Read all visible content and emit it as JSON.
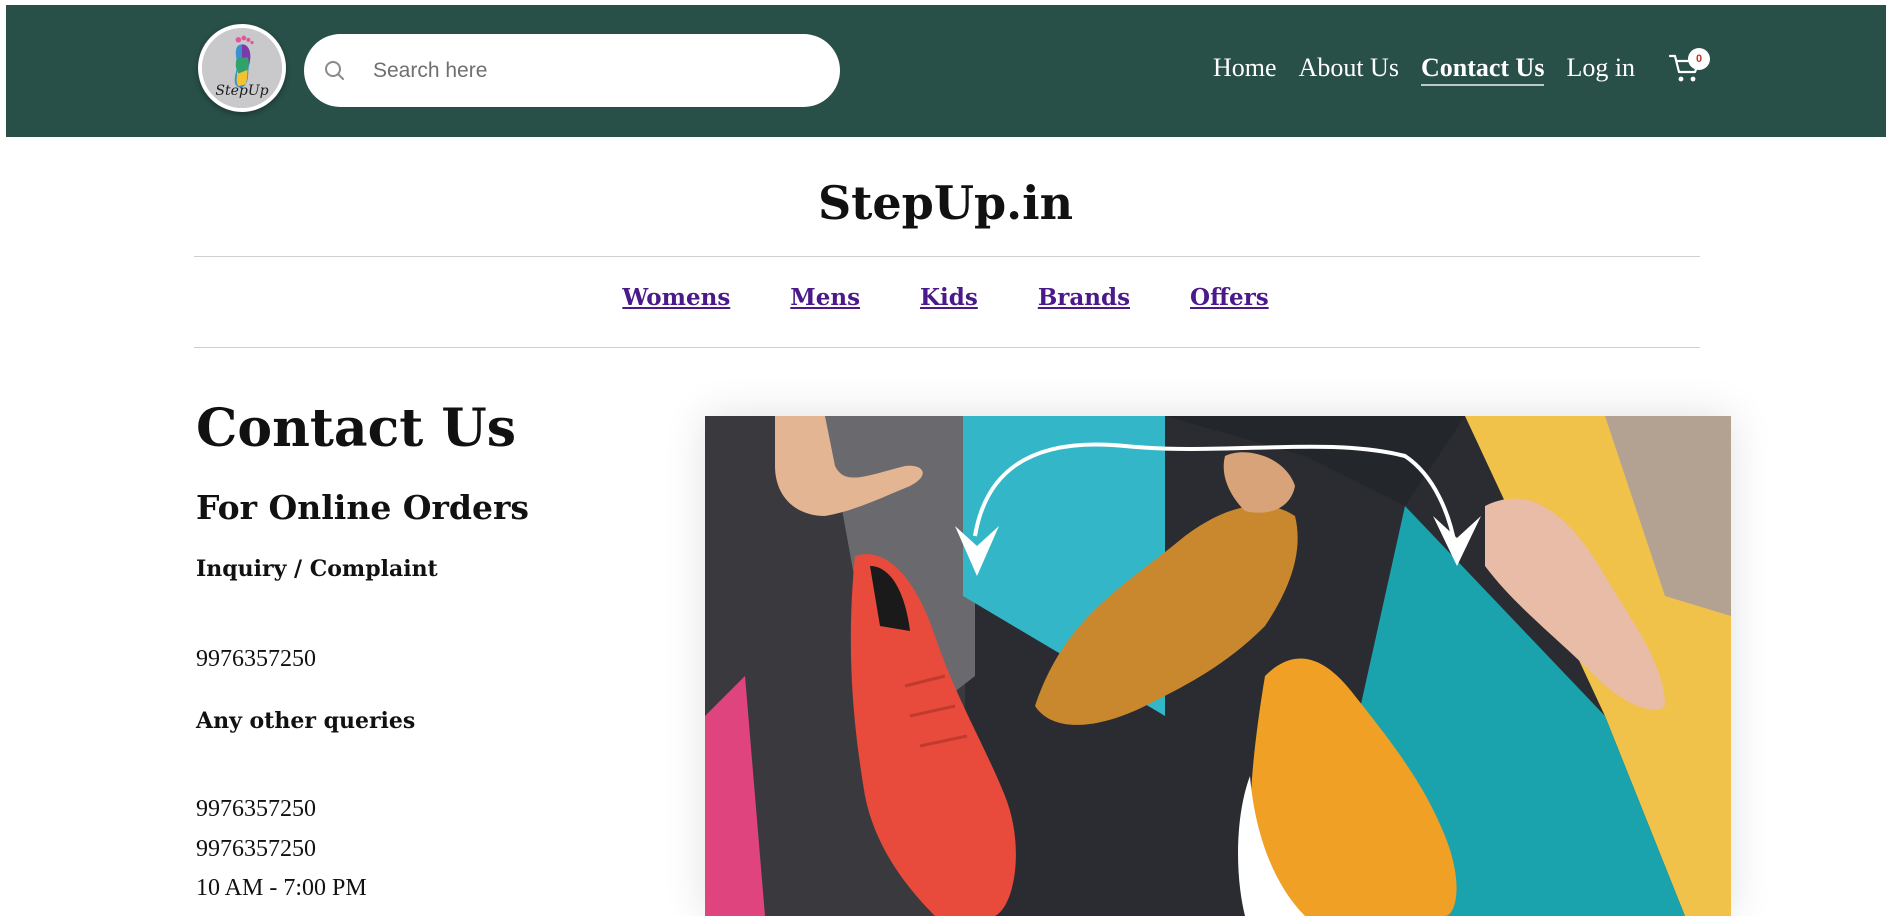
{
  "header": {
    "logo_text": "StepUp",
    "search": {
      "placeholder": "Search here",
      "value": ""
    },
    "nav": [
      {
        "label": "Home",
        "active": false
      },
      {
        "label": "About Us",
        "active": false
      },
      {
        "label": "Contact Us",
        "active": true
      },
      {
        "label": "Log in",
        "active": false
      }
    ],
    "cart_count": "0"
  },
  "brand": {
    "title": "StepUp.in"
  },
  "categories": [
    "Womens",
    "Mens",
    "Kids",
    "Brands",
    "Offers"
  ],
  "contact": {
    "heading": "Contact Us",
    "subheading": "For Online Orders",
    "inquiry_label": "Inquiry / Complaint",
    "inquiry_phone": "9976357250",
    "other_label": "Any other queries",
    "other_phone_1": "9976357250",
    "other_phone_2": "9976357250",
    "hours": "10 AM - 7:00 PM"
  },
  "colors": {
    "header_bg": "#285048",
    "category_link": "#4b1a8a"
  },
  "icons": {
    "search": "search-icon",
    "cart": "cart-icon",
    "logo": "footprint-logo"
  }
}
